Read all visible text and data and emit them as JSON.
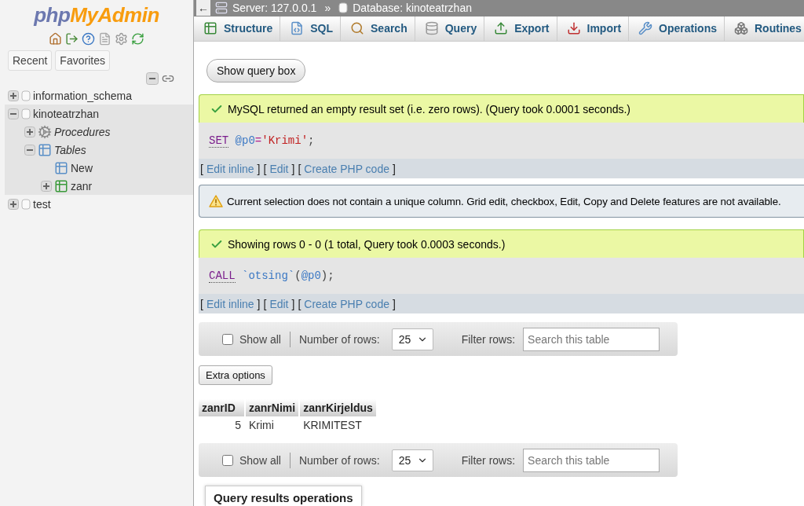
{
  "sidebar": {
    "logo": {
      "part_1": "php",
      "part_2": "MyAdmin"
    },
    "tabs": [
      {
        "label": "Recent"
      },
      {
        "label": "Favorites"
      }
    ],
    "tree": [
      {
        "label": "information_schema",
        "kind": "database",
        "expanded": false,
        "selected": false
      },
      {
        "label": "kinoteatrzhan",
        "kind": "database",
        "expanded": true,
        "selected": true,
        "children": [
          {
            "label": "Procedures",
            "kind": "group",
            "expanded": false
          },
          {
            "label": "Tables",
            "kind": "group",
            "expanded": true,
            "children": [
              {
                "label": "New",
                "kind": "new"
              },
              {
                "label": "zanr",
                "kind": "table",
                "expanded": false
              }
            ]
          }
        ]
      },
      {
        "label": "test",
        "kind": "database",
        "expanded": false,
        "selected": false
      }
    ]
  },
  "breadcrumb": {
    "back": "←",
    "server": "Server: 127.0.0.1",
    "separator": "»",
    "database": "Database: kinoteatrzhan"
  },
  "tabs": [
    {
      "label": "Structure",
      "selected": false
    },
    {
      "label": "SQL",
      "selected": false
    },
    {
      "label": "Search",
      "selected": false
    },
    {
      "label": "Query",
      "selected": false
    },
    {
      "label": "Export",
      "selected": false
    },
    {
      "label": "Import",
      "selected": false
    },
    {
      "label": "Operations",
      "selected": false
    },
    {
      "label": "Routines",
      "selected": false
    }
  ],
  "show_query_button": "Show query box",
  "blocks": [
    {
      "kind": "result",
      "message": "MySQL returned an empty result set (i.e. zero rows). (Query took 0.0001 seconds.)",
      "sql": [
        {
          "kind": "keyword",
          "text": "SET"
        },
        {
          "kind": "variable",
          "text": "@p0"
        },
        {
          "kind": "operator",
          "text": "="
        },
        {
          "kind": "string",
          "text": "'Krimi'"
        },
        {
          "kind": "punct",
          "text": ";"
        }
      ],
      "links": [
        "Edit inline",
        "Edit",
        "Create PHP code"
      ],
      "bracket_open": "[",
      "bracket_close": "]"
    },
    {
      "kind": "warning",
      "message": "Current selection does not contain a unique column. Grid edit, checkbox, Edit, Copy and Delete features are not available."
    },
    {
      "kind": "result",
      "message": "Showing rows 0 - 0 (1 total, Query took 0.0003 seconds.)",
      "sql": [
        {
          "kind": "keyword",
          "text": "CALL"
        },
        {
          "kind": "identifier",
          "text": "`otsing`"
        },
        {
          "kind": "punct",
          "text": "("
        },
        {
          "kind": "variable",
          "text": "@p0"
        },
        {
          "kind": "punct",
          "text": ");"
        }
      ],
      "links": [
        "Edit inline",
        "Edit",
        "Create PHP code"
      ],
      "bracket_open": "[",
      "bracket_close": "]"
    }
  ],
  "navigation_top": {
    "show_all": {
      "label": "Show all",
      "checked": false
    },
    "rows_label": "Number of rows:",
    "rows_value": "25",
    "filter_label": "Filter rows:",
    "filter_placeholder": "Search this table"
  },
  "extra_options": "Extra options",
  "table": {
    "columns": [
      "zanrID",
      "zanrNimi",
      "zanrKirjeldus"
    ],
    "rows": [
      [
        "5",
        "Krimi",
        "KRIMITEST"
      ]
    ]
  },
  "navigation_bottom": {
    "show_all": {
      "label": "Show all",
      "checked": false
    },
    "rows_label": "Number of rows:",
    "rows_value": "25",
    "filter_label": "Filter rows:",
    "filter_placeholder": "Search this table"
  },
  "operations_heading": "Query results operations"
}
